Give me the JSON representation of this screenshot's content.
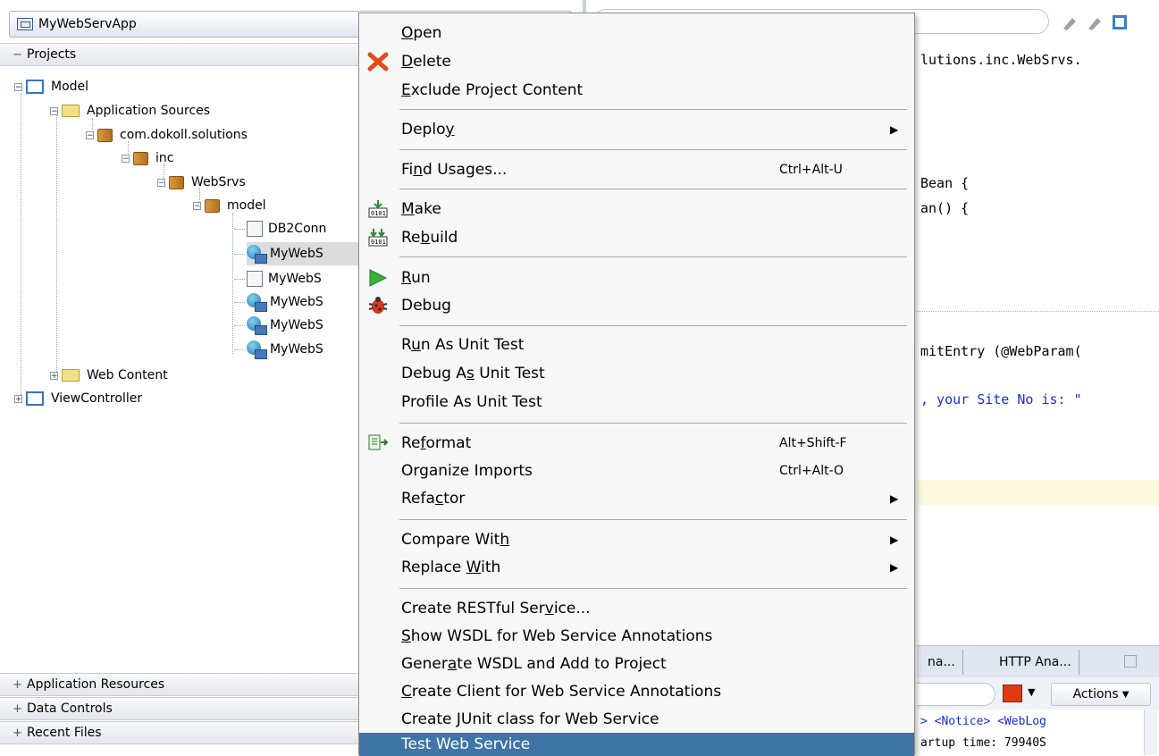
{
  "navigator": {
    "app_name": "MyWebServApp",
    "projects_header": "Projects",
    "tree": [
      {
        "label": "Model",
        "type": "project"
      },
      {
        "label": "Application Sources",
        "type": "folder"
      },
      {
        "label": "com.dokoll.solutions",
        "type": "package"
      },
      {
        "label": "inc",
        "type": "package"
      },
      {
        "label": "WebSrvs",
        "type": "package"
      },
      {
        "label": "model",
        "type": "package"
      },
      {
        "label": "DB2Conn",
        "type": "file"
      },
      {
        "label": "MyWebS",
        "type": "webservice"
      },
      {
        "label": "MyWebS",
        "type": "file"
      },
      {
        "label": "MyWebS",
        "type": "webservice"
      },
      {
        "label": "MyWebS",
        "type": "webservice"
      },
      {
        "label": "MyWebS",
        "type": "webservice"
      },
      {
        "label": "Web Content",
        "type": "folder"
      },
      {
        "label": "ViewController",
        "type": "project"
      }
    ],
    "bottom_sections": [
      "Application Resources",
      "Data Controls",
      "Recent Files"
    ]
  },
  "editor": {
    "code_lines": [
      "lutions.inc.WebSrvs.",
      "Bean {",
      "an() {",
      "mitEntry (@WebParam(",
      ", your Site No is: \""
    ],
    "log_tabs": [
      "na...",
      "HTTP Ana..."
    ],
    "actions_label": "Actions",
    "log_lines": [
      "> <Notice> <WebLog",
      "artup time: 79940S"
    ]
  },
  "context_menu": {
    "items": [
      {
        "pre": "",
        "mn": "O",
        "post": "pen",
        "icon": "",
        "shortcut": "",
        "submenu": false
      },
      {
        "pre": "",
        "mn": "D",
        "post": "elete",
        "icon": "delete-icon",
        "shortcut": "",
        "submenu": false
      },
      {
        "pre": "",
        "mn": "E",
        "post": "xclude Project Content",
        "icon": "",
        "shortcut": "",
        "submenu": false
      },
      {
        "pre": "Deplo",
        "mn": "y",
        "post": "",
        "icon": "",
        "shortcut": "",
        "submenu": true
      },
      {
        "pre": "Fi",
        "mn": "n",
        "post": "d Usages...",
        "icon": "",
        "shortcut": "Ctrl+Alt-U",
        "submenu": false
      },
      {
        "pre": "",
        "mn": "M",
        "post": "ake",
        "icon": "make-icon",
        "shortcut": "",
        "submenu": false
      },
      {
        "pre": "Re",
        "mn": "b",
        "post": "uild",
        "icon": "rebuild-icon",
        "shortcut": "",
        "submenu": false
      },
      {
        "pre": "",
        "mn": "R",
        "post": "un",
        "icon": "run-icon",
        "shortcut": "",
        "submenu": false
      },
      {
        "pre": "Debu",
        "mn": "g",
        "post": "",
        "icon": "debug-icon",
        "shortcut": "",
        "submenu": false
      },
      {
        "pre": "R",
        "mn": "u",
        "post": "n As Unit Test",
        "icon": "",
        "shortcut": "",
        "submenu": false
      },
      {
        "pre": "Debug A",
        "mn": "s",
        "post": " Unit Test",
        "icon": "",
        "shortcut": "",
        "submenu": false
      },
      {
        "pre": "Prof",
        "mn": "i",
        "post": "le As Unit Test",
        "icon": "",
        "shortcut": "",
        "submenu": false
      },
      {
        "pre": "Re",
        "mn": "f",
        "post": "ormat",
        "icon": "reformat-icon",
        "shortcut": "Alt+Shift-F",
        "submenu": false
      },
      {
        "pre": "Organize Imports",
        "mn": "",
        "post": "",
        "icon": "",
        "shortcut": "Ctrl+Alt-O",
        "submenu": false
      },
      {
        "pre": "Refa",
        "mn": "c",
        "post": "tor",
        "icon": "",
        "shortcut": "",
        "submenu": true
      },
      {
        "pre": "Compare Wit",
        "mn": "h",
        "post": "",
        "icon": "",
        "shortcut": "",
        "submenu": true
      },
      {
        "pre": "Replace ",
        "mn": "W",
        "post": "ith",
        "icon": "",
        "shortcut": "",
        "submenu": true
      },
      {
        "pre": "Create RESTful Ser",
        "mn": "v",
        "post": "ice...",
        "icon": "",
        "shortcut": "",
        "submenu": false
      },
      {
        "pre": "",
        "mn": "S",
        "post": "how WSDL for Web Service Annotations",
        "icon": "",
        "shortcut": "",
        "submenu": false
      },
      {
        "pre": "Gener",
        "mn": "a",
        "post": "te WSDL and Add to Project",
        "icon": "",
        "shortcut": "",
        "submenu": false
      },
      {
        "pre": "",
        "mn": "C",
        "post": "reate Client for Web Service Annotations",
        "icon": "",
        "shortcut": "",
        "submenu": false
      },
      {
        "pre": "Create ",
        "mn": "J",
        "post": "Unit class for Web Service",
        "icon": "",
        "shortcut": "",
        "submenu": false
      },
      {
        "pre": "Test Web Service",
        "mn": "",
        "post": "",
        "icon": "",
        "shortcut": "",
        "submenu": false,
        "highlighted": true
      }
    ]
  },
  "colors": {
    "menu_highlight": "#3f74a6",
    "code_string": "#1b2fd1",
    "current_line": "#fbf8dc"
  }
}
